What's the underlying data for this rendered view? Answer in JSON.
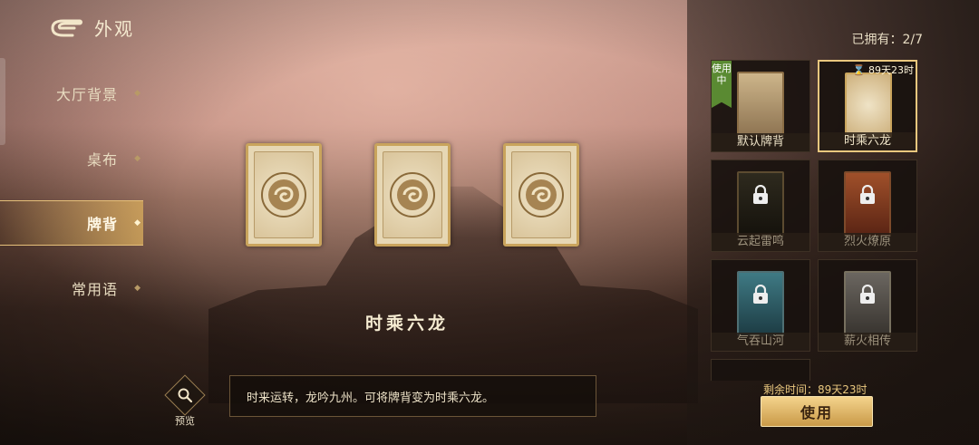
{
  "header": {
    "title": "外观"
  },
  "sidebar": {
    "items": [
      {
        "label": "大厅背景"
      },
      {
        "label": "桌布"
      },
      {
        "label": "牌背"
      },
      {
        "label": "常用语"
      }
    ]
  },
  "main": {
    "deck_name": "时乘六龙",
    "description": "时来运转，龙吟九州。可将牌背变为时乘六龙。",
    "preview_label": "预览"
  },
  "collection": {
    "owned_label": "已拥有：2/7",
    "items": [
      {
        "name": "默认牌背",
        "badge": "使用中"
      },
      {
        "name": "时乘六龙",
        "timer": "89天23时"
      },
      {
        "name": "云起雷鸣"
      },
      {
        "name": "烈火燎原"
      },
      {
        "name": "气吞山河"
      },
      {
        "name": "薪火相传"
      }
    ],
    "remaining_label": "剩余时间：89天23时",
    "use_button": "使用"
  },
  "colors": {
    "accent_gold": "#e9c77e",
    "in_use_green": "#5a8a32",
    "panel_dark": "#1a130f"
  },
  "icons": [
    "back-arrow-icon",
    "search-icon",
    "lock-icon",
    "hourglass-icon",
    "chevron-right-icon",
    "dragon-emblem-icon"
  ]
}
